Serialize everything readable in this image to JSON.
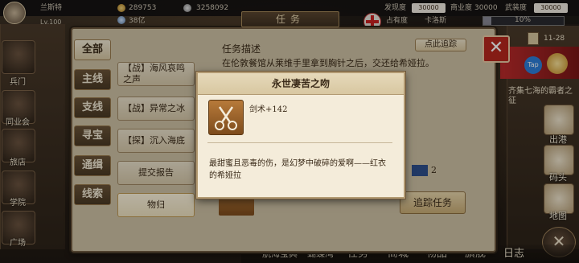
{
  "player": {
    "name": "兰斯特",
    "level": "Lv.100",
    "gold": "289753",
    "currency2": "3258092",
    "small_stat": "38亿"
  },
  "status": {
    "discover_label": "发现度",
    "discover_value": "30000",
    "merchant_label": "商业度",
    "merchant_value": "30000",
    "combat_label": "武装度",
    "combat_value": "30000",
    "occupy_label": "占有度",
    "occupy_value": "卡洛斯",
    "percent": "10%",
    "time": "11-28"
  },
  "left_nav": [
    {
      "label": "兵门"
    },
    {
      "label": "同业会"
    },
    {
      "label": "旅店"
    },
    {
      "label": "学院"
    },
    {
      "label": "广场"
    }
  ],
  "panel": {
    "title": "任务",
    "categories": [
      {
        "label": "全部",
        "active": true
      },
      {
        "label": "主线",
        "active": false
      },
      {
        "label": "支线",
        "active": false
      },
      {
        "label": "寻宝",
        "active": false
      },
      {
        "label": "通缉",
        "active": false
      },
      {
        "label": "线索",
        "active": false
      }
    ],
    "tasks": [
      {
        "label": "【战】海风哀鸣之声"
      },
      {
        "label": "【战】异常之冰"
      },
      {
        "label": "【探】沉入海底"
      },
      {
        "label": "提交报告"
      },
      {
        "label": "物归"
      }
    ],
    "desc_title": "任务描述",
    "desc_text": "在伦敦餐馆从莱维手里拿到胸针之后，交还给希娅拉。",
    "track_small": "点此追踪",
    "track_button": "追踪任务",
    "reward_count": "2"
  },
  "popup": {
    "title": "永世凄苦之吻",
    "reward": "剑术+142",
    "flavor": "最甜蜜且恶毒的伤，是幻梦中破碎的爱啊——红衣的希娅拉"
  },
  "right_nav": [
    {
      "label": "出港"
    },
    {
      "label": "码头"
    },
    {
      "label": "地图"
    }
  ],
  "right_banner": {
    "text1": "齐集七海的霸者之征",
    "tap": "Tap"
  },
  "bottom_menu": [
    {
      "label": "航海宝典"
    },
    {
      "label": "蝴蝶湾"
    },
    {
      "label": "任务"
    },
    {
      "label": "商城"
    },
    {
      "label": "物品"
    },
    {
      "label": "旗舰"
    },
    {
      "label": "日志"
    }
  ],
  "colors": {
    "panel_bg": "#cfc2a5",
    "popup_bg": "#f4ecda",
    "close_red": "#b8271e",
    "accent_brown": "#6f5a41"
  }
}
